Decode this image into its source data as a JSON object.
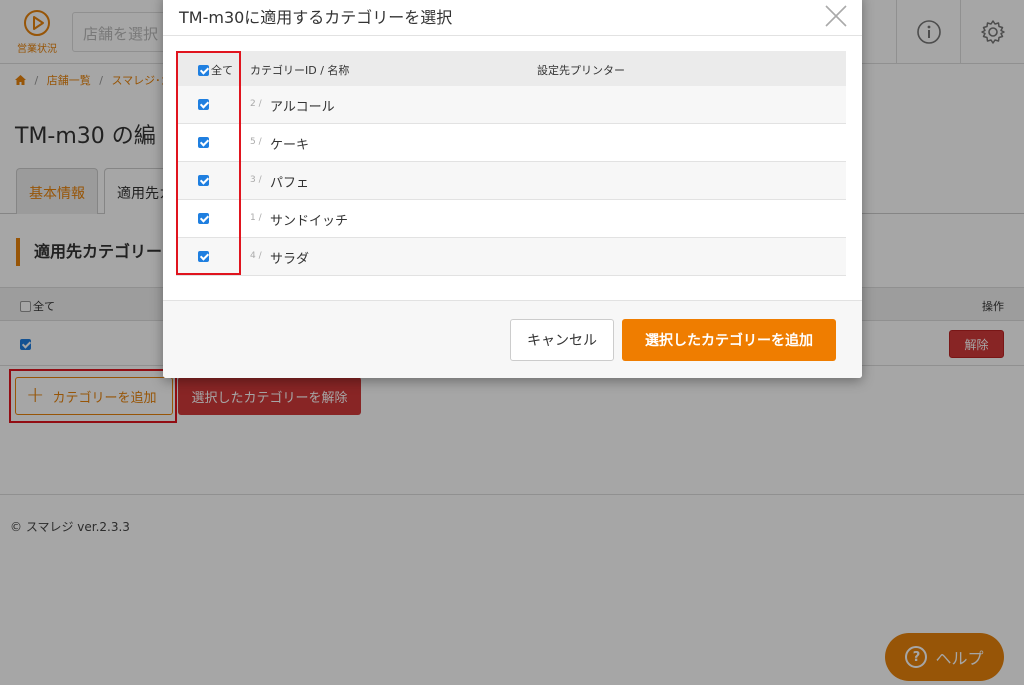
{
  "header": {
    "sales_status_label": "営業状況",
    "store_select_placeholder": "店舗を選択"
  },
  "breadcrumb": {
    "items": [
      "店舗一覧",
      "スマレジ･カ"
    ]
  },
  "page": {
    "title": "TM-m30 の編",
    "tabs": [
      {
        "label": "基本情報"
      },
      {
        "label": "適用先カ"
      }
    ],
    "section_title": "適用先カテゴリー",
    "table": {
      "select_all_label": "全て",
      "ops_header": "操作",
      "row_checked": true,
      "remove_label": "解除"
    },
    "add_category_label": "カテゴリーを追加",
    "bulk_remove_label": "選択したカテゴリーを解除"
  },
  "footer": {
    "copyright": "© スマレジ ver.2.3.3"
  },
  "help": {
    "label": "ヘルプ"
  },
  "modal": {
    "title": "TM-m30に適用するカテゴリーを選択",
    "columns": {
      "select_all": "全て",
      "name": "カテゴリーID / 名称",
      "printer": "設定先プリンター"
    },
    "select_all_checked": true,
    "rows": [
      {
        "id": "2 /",
        "name": "アルコール",
        "checked": true
      },
      {
        "id": "5 /",
        "name": "ケーキ",
        "checked": true
      },
      {
        "id": "3 /",
        "name": "パフェ",
        "checked": true
      },
      {
        "id": "1 /",
        "name": "サンドイッチ",
        "checked": true
      },
      {
        "id": "4 /",
        "name": "サラダ",
        "checked": true
      }
    ],
    "cancel_label": "キャンセル",
    "add_selected_label": "選択したカテゴリーを追加"
  },
  "colors": {
    "accent": "#e8830c",
    "danger": "#d13a3a",
    "checkbox": "#1f7fe0",
    "highlight": "#e0141e"
  }
}
